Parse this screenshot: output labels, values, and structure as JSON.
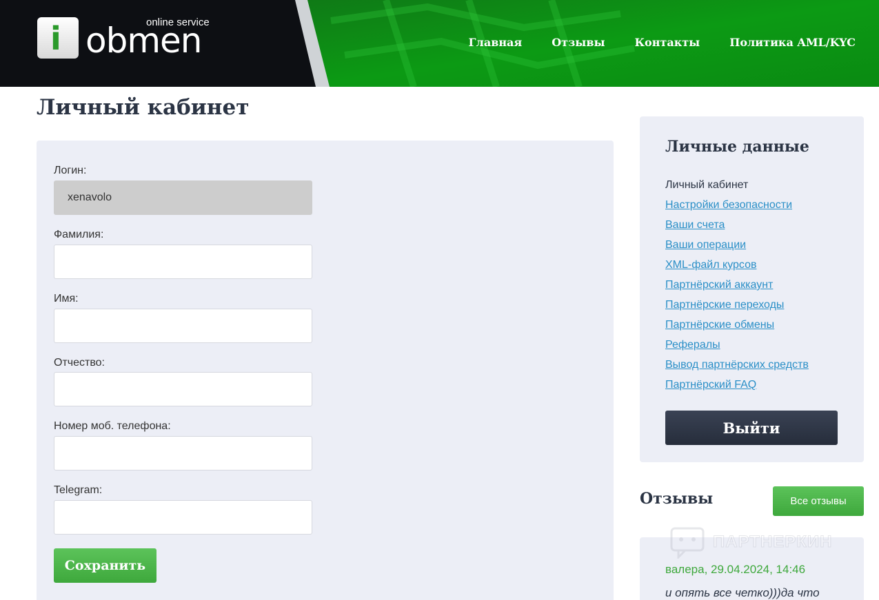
{
  "header": {
    "logo_letter": "i",
    "logo_word": "obmen",
    "logo_tagline": "online service",
    "nav": [
      "Главная",
      "Отзывы",
      "Контакты",
      "Политика AML/KYC"
    ]
  },
  "page_title": "Личный кабинет",
  "form": {
    "fields": [
      {
        "label": "Логин:",
        "value": "xenavolo",
        "readonly": true
      },
      {
        "label": "Фамилия:",
        "value": ""
      },
      {
        "label": "Имя:",
        "value": ""
      },
      {
        "label": "Отчество:",
        "value": ""
      },
      {
        "label": "Номер моб. телефона:",
        "value": ""
      },
      {
        "label": "Telegram:",
        "value": ""
      }
    ],
    "save_label": "Сохранить"
  },
  "sidebar": {
    "title": "Личные данные",
    "current": "Личный кабинет",
    "links": [
      "Настройки безопасности",
      "Ваши счета",
      "Ваши операции",
      "XML-файл курсов",
      "Партнёрский аккаунт",
      "Партнёрские переходы",
      "Партнёрские обмены",
      "Рефералы",
      "Вывод партнёрских средств",
      "Партнёрский FAQ"
    ],
    "logout_label": "Выйти"
  },
  "reviews": {
    "title": "Отзывы",
    "all_label": "Все отзывы",
    "items": [
      {
        "meta": "валера, 29.04.2024, 14:46",
        "text": "и опять все четко)))да что"
      }
    ]
  },
  "watermark": "ПАРТНЕРКИН",
  "colors": {
    "accent_green": "#3ea83c",
    "link_blue": "#2a8fc7",
    "dark_text": "#2b3444",
    "panel_bg": "#eceef6"
  }
}
